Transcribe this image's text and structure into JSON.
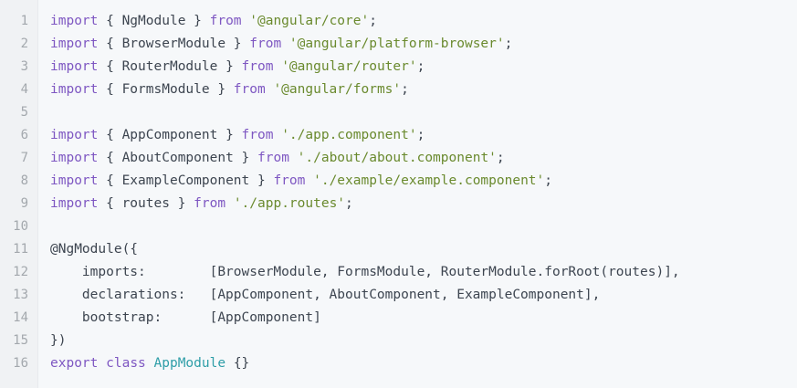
{
  "editor": {
    "colors": {
      "background": "#f6f8fa",
      "line_number": "#a3a8ad",
      "keyword": "#7e57c2",
      "string": "#6a8a2e",
      "class_name": "#2f9ea8",
      "plain": "#3d4550"
    },
    "lines": [
      {
        "number": "1",
        "tokens": [
          {
            "t": "keyword",
            "v": "import"
          },
          {
            "t": "plain",
            "v": " { NgModule } "
          },
          {
            "t": "keyword",
            "v": "from"
          },
          {
            "t": "plain",
            "v": " "
          },
          {
            "t": "string",
            "v": "'@angular/core'"
          },
          {
            "t": "plain",
            "v": ";"
          }
        ]
      },
      {
        "number": "2",
        "tokens": [
          {
            "t": "keyword",
            "v": "import"
          },
          {
            "t": "plain",
            "v": " { BrowserModule } "
          },
          {
            "t": "keyword",
            "v": "from"
          },
          {
            "t": "plain",
            "v": " "
          },
          {
            "t": "string",
            "v": "'@angular/platform-browser'"
          },
          {
            "t": "plain",
            "v": ";"
          }
        ]
      },
      {
        "number": "3",
        "tokens": [
          {
            "t": "keyword",
            "v": "import"
          },
          {
            "t": "plain",
            "v": " { RouterModule } "
          },
          {
            "t": "keyword",
            "v": "from"
          },
          {
            "t": "plain",
            "v": " "
          },
          {
            "t": "string",
            "v": "'@angular/router'"
          },
          {
            "t": "plain",
            "v": ";"
          }
        ]
      },
      {
        "number": "4",
        "tokens": [
          {
            "t": "keyword",
            "v": "import"
          },
          {
            "t": "plain",
            "v": " { FormsModule } "
          },
          {
            "t": "keyword",
            "v": "from"
          },
          {
            "t": "plain",
            "v": " "
          },
          {
            "t": "string",
            "v": "'@angular/forms'"
          },
          {
            "t": "plain",
            "v": ";"
          }
        ]
      },
      {
        "number": "5",
        "tokens": []
      },
      {
        "number": "6",
        "tokens": [
          {
            "t": "keyword",
            "v": "import"
          },
          {
            "t": "plain",
            "v": " { AppComponent } "
          },
          {
            "t": "keyword",
            "v": "from"
          },
          {
            "t": "plain",
            "v": " "
          },
          {
            "t": "string",
            "v": "'./app.component'"
          },
          {
            "t": "plain",
            "v": ";"
          }
        ]
      },
      {
        "number": "7",
        "tokens": [
          {
            "t": "keyword",
            "v": "import"
          },
          {
            "t": "plain",
            "v": " { AboutComponent } "
          },
          {
            "t": "keyword",
            "v": "from"
          },
          {
            "t": "plain",
            "v": " "
          },
          {
            "t": "string",
            "v": "'./about/about.component'"
          },
          {
            "t": "plain",
            "v": ";"
          }
        ]
      },
      {
        "number": "8",
        "tokens": [
          {
            "t": "keyword",
            "v": "import"
          },
          {
            "t": "plain",
            "v": " { ExampleComponent } "
          },
          {
            "t": "keyword",
            "v": "from"
          },
          {
            "t": "plain",
            "v": " "
          },
          {
            "t": "string",
            "v": "'./example/example.component'"
          },
          {
            "t": "plain",
            "v": ";"
          }
        ]
      },
      {
        "number": "9",
        "tokens": [
          {
            "t": "keyword",
            "v": "import"
          },
          {
            "t": "plain",
            "v": " { routes } "
          },
          {
            "t": "keyword",
            "v": "from"
          },
          {
            "t": "plain",
            "v": " "
          },
          {
            "t": "string",
            "v": "'./app.routes'"
          },
          {
            "t": "plain",
            "v": ";"
          }
        ]
      },
      {
        "number": "10",
        "tokens": []
      },
      {
        "number": "11",
        "tokens": [
          {
            "t": "plain",
            "v": "@NgModule({"
          }
        ]
      },
      {
        "number": "12",
        "tokens": [
          {
            "t": "plain",
            "v": "    imports:        [BrowserModule, FormsModule, RouterModule.forRoot(routes)],"
          }
        ]
      },
      {
        "number": "13",
        "tokens": [
          {
            "t": "plain",
            "v": "    declarations:   [AppComponent, AboutComponent, ExampleComponent],"
          }
        ]
      },
      {
        "number": "14",
        "tokens": [
          {
            "t": "plain",
            "v": "    bootstrap:      [AppComponent]"
          }
        ]
      },
      {
        "number": "15",
        "tokens": [
          {
            "t": "plain",
            "v": "})"
          }
        ]
      },
      {
        "number": "16",
        "tokens": [
          {
            "t": "keyword",
            "v": "export"
          },
          {
            "t": "plain",
            "v": " "
          },
          {
            "t": "keyword",
            "v": "class"
          },
          {
            "t": "plain",
            "v": " "
          },
          {
            "t": "class",
            "v": "AppModule"
          },
          {
            "t": "plain",
            "v": " {}"
          }
        ]
      }
    ]
  }
}
